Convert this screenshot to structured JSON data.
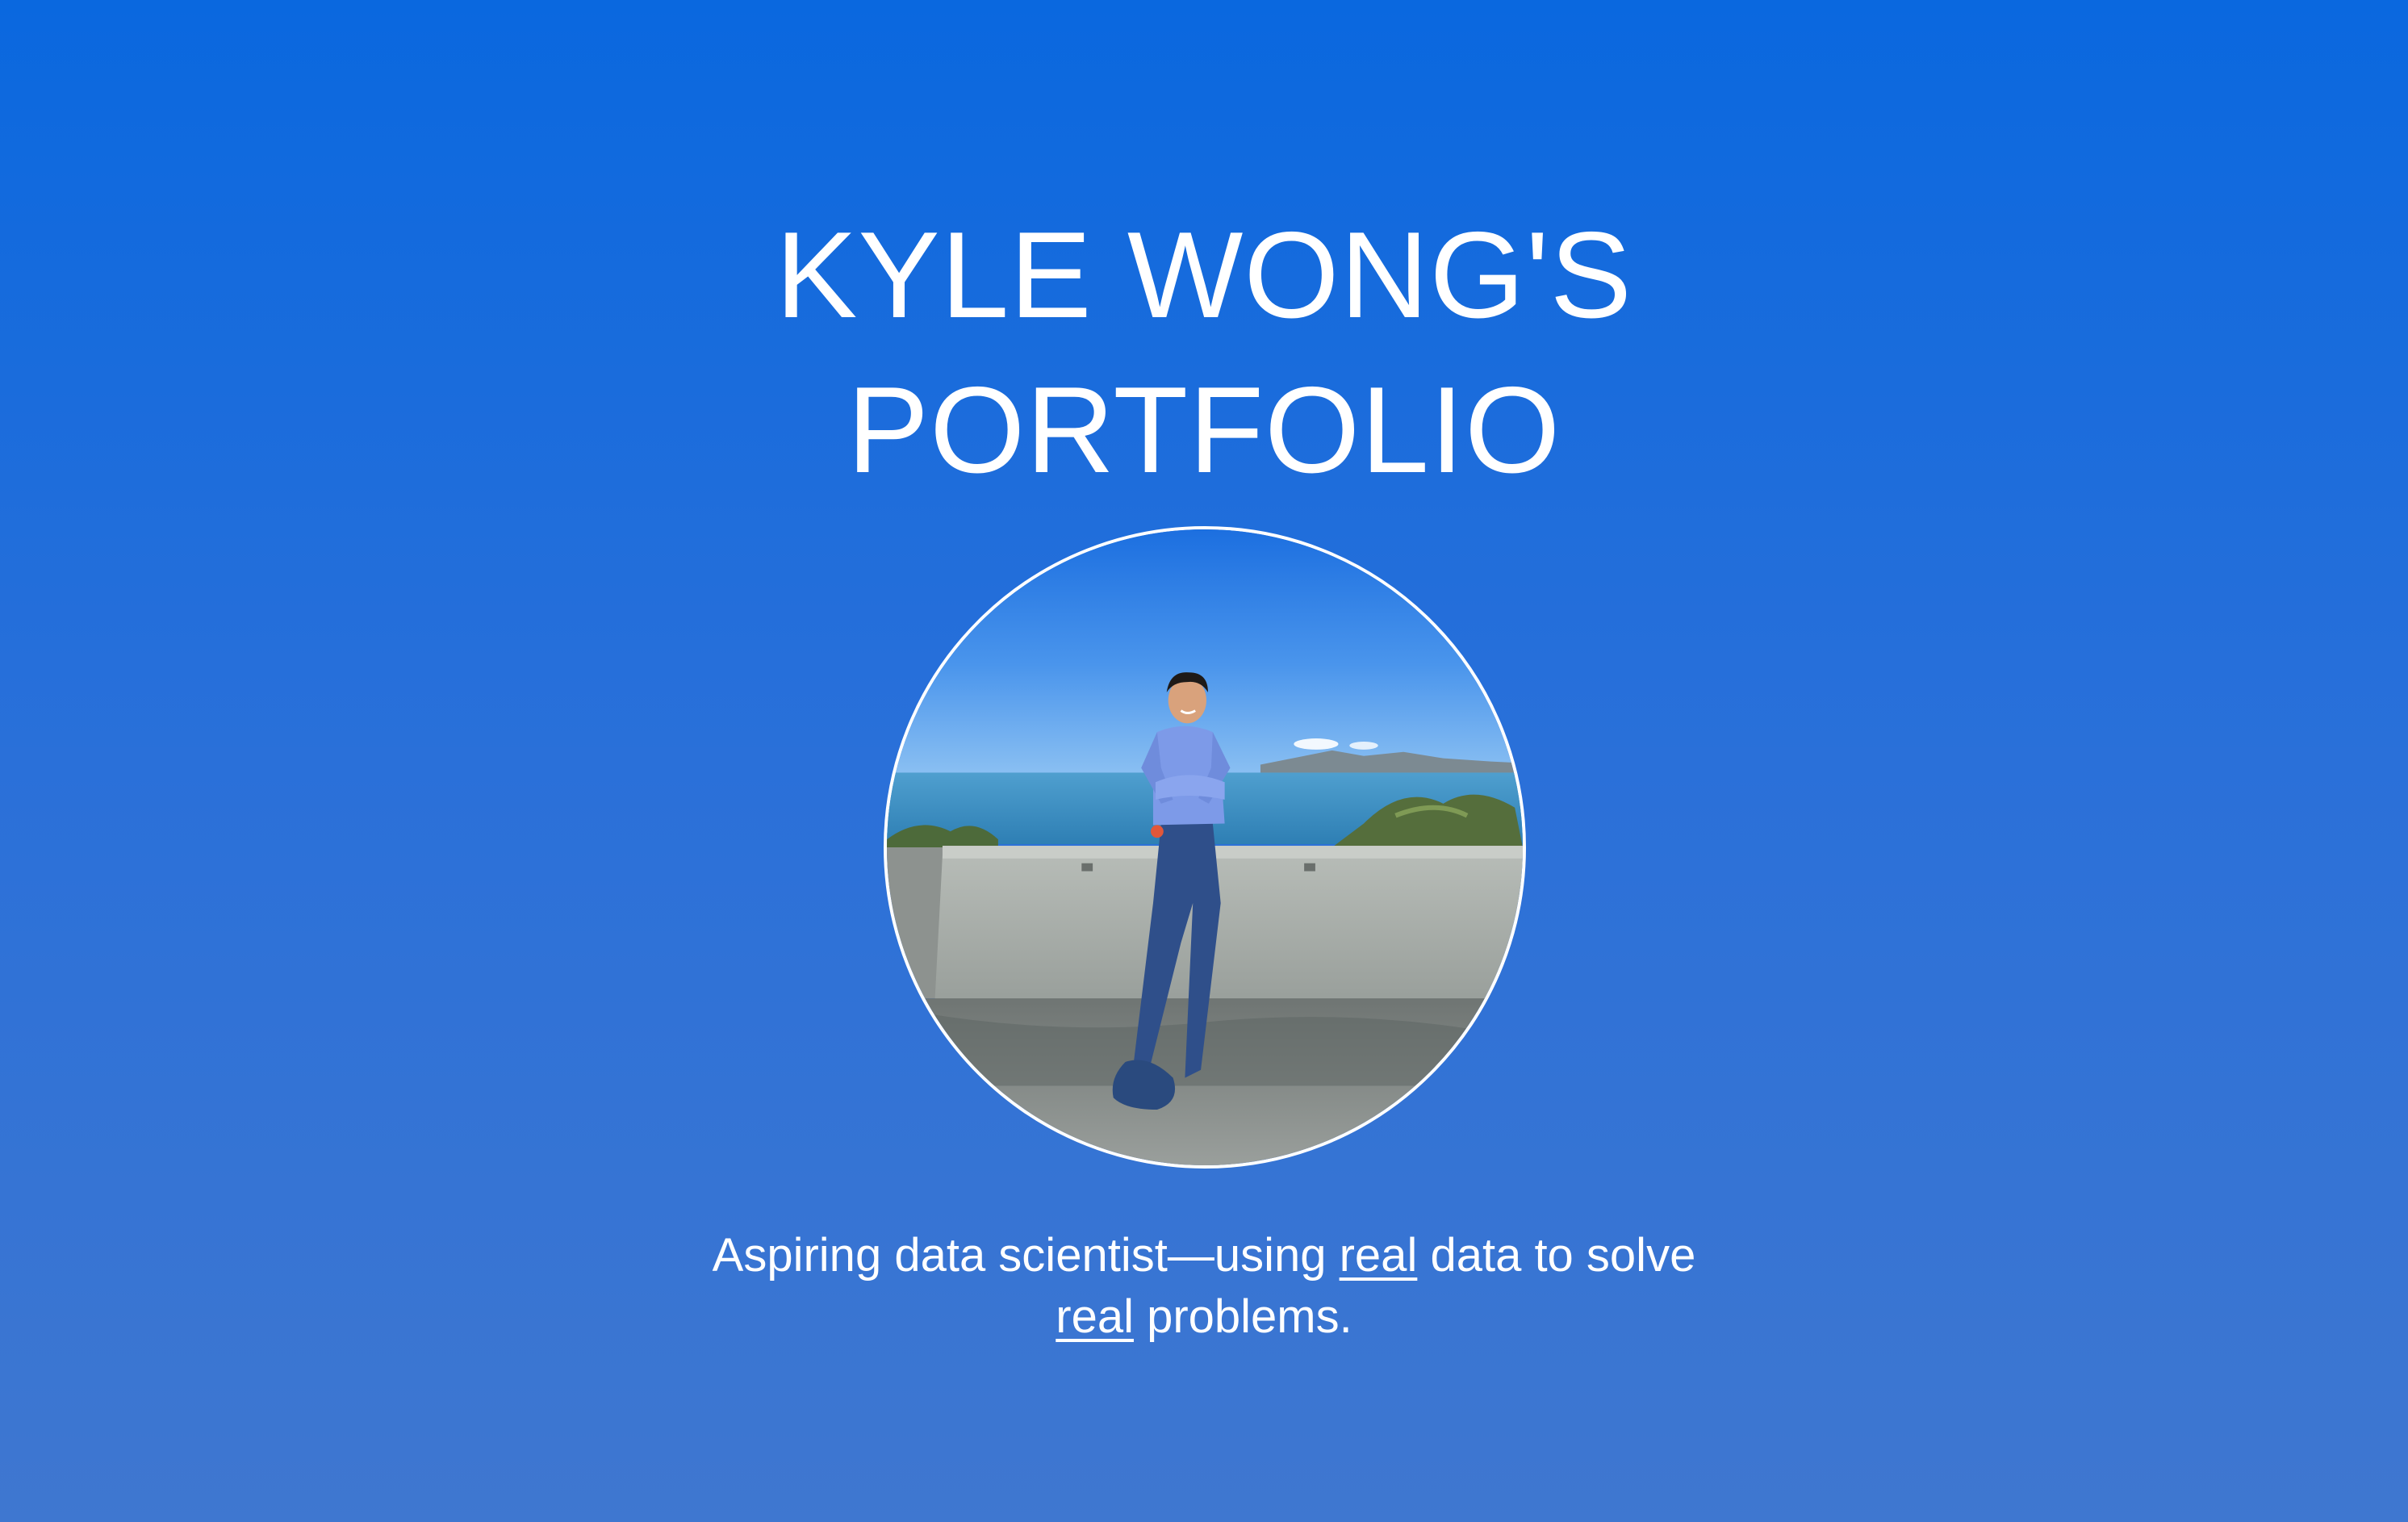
{
  "page": {
    "title_line1": "KYLE WONG'S",
    "title_line2": "PORTFOLIO",
    "photo_alt": "Portrait of Kyle Wong sitting on a concrete wall by the ocean",
    "tagline": {
      "line1_before": "Aspiring data scientist—using ",
      "emphasis": "real",
      "line1_after": " data to solve",
      "line2_after": " problems."
    }
  },
  "colors": {
    "gradient_top": "#0a68df",
    "gradient_bottom": "#3f77d0",
    "text": "#ffffff"
  }
}
